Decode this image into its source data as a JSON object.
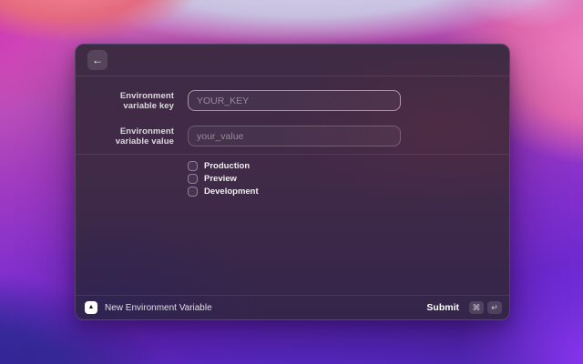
{
  "window": {
    "header": {
      "back_icon": "←"
    },
    "form": {
      "fields": [
        {
          "label": "Environment variable key",
          "placeholder": "YOUR_KEY",
          "value": "",
          "focused": true
        },
        {
          "label": "Environment variable value",
          "placeholder": "your_value",
          "value": "",
          "focused": false
        }
      ],
      "checkboxes": [
        {
          "label": "Production",
          "checked": false
        },
        {
          "label": "Preview",
          "checked": false
        },
        {
          "label": "Development",
          "checked": false
        }
      ]
    },
    "footer": {
      "app_icon_glyph": "▲",
      "title": "New Environment Variable",
      "submit_label": "Submit",
      "shortcut_keys": [
        "⌘",
        "↵"
      ]
    }
  },
  "colors": {
    "window_bg": "#3d2946",
    "focused_input_border": "rgba(255,255,255,0.5)",
    "input_border": "rgba(255,255,255,0.22)",
    "divider": "rgba(255,255,255,0.09)",
    "wallpaper_top": "#c9c2e2",
    "wallpaper_pink": "#e067ae",
    "wallpaper_violet": "#6a28cf"
  }
}
